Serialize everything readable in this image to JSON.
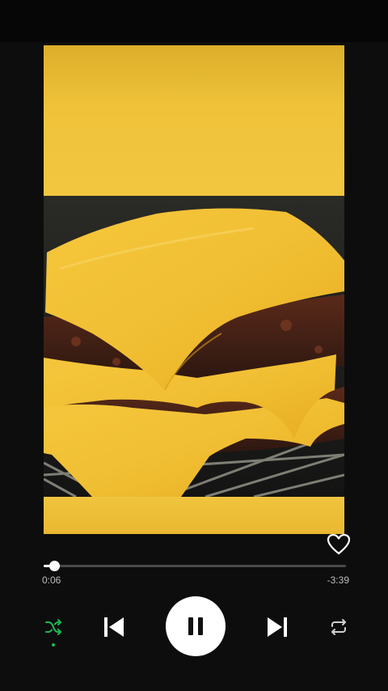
{
  "player": {
    "elapsed": "0:06",
    "remaining": "-3:39",
    "progress_fraction": 0.035,
    "shuffle_active": true,
    "liked": false,
    "state": "playing"
  },
  "icons": {
    "like": "heart-outline-icon",
    "shuffle": "shuffle-icon",
    "previous": "skip-previous-icon",
    "play_pause": "pause-icon",
    "next": "skip-next-icon",
    "repeat": "repeat-icon"
  },
  "colors": {
    "background": "#0d0d0d",
    "accent": "#1db954",
    "track": "#4a4a4a",
    "foreground": "#ffffff"
  }
}
